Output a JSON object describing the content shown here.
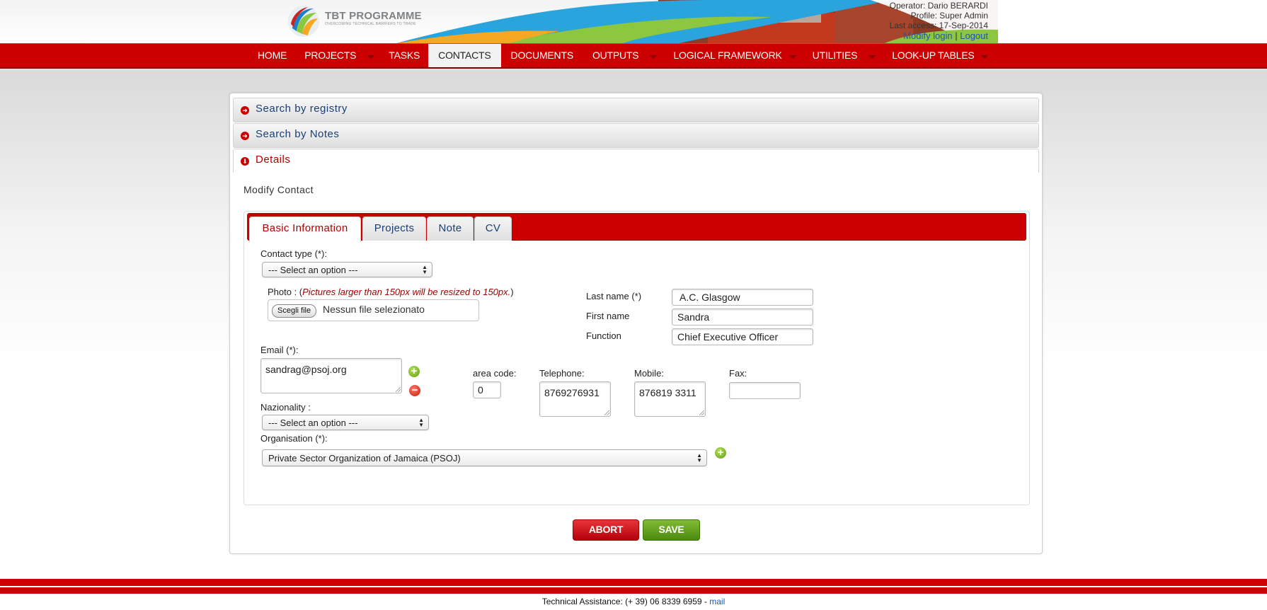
{
  "header": {
    "logo_title": "TBT PROGRAMME",
    "logo_tagline": "OVERCOMING TECHNICAL BARRIERS TO TRADE",
    "operator": "Operator: Dario BERARDI",
    "profile": "Profile: Super Admin",
    "last_access": "Last access: 17-Sep-2014",
    "modify_login": "Modify login",
    "separator": "|",
    "logout": "Logout"
  },
  "nav": {
    "items": [
      {
        "label": "HOME",
        "dropdown": false
      },
      {
        "label": "PROJECTS",
        "dropdown": true
      },
      {
        "label": "TASKS",
        "dropdown": false
      },
      {
        "label": "CONTACTS",
        "dropdown": false,
        "active": true
      },
      {
        "label": "DOCUMENTS",
        "dropdown": false
      },
      {
        "label": "OUTPUTS",
        "dropdown": true
      },
      {
        "label": "LOGICAL FRAMEWORK",
        "dropdown": true
      },
      {
        "label": "UTILITIES",
        "dropdown": true
      },
      {
        "label": "LOOK-UP TABLES",
        "dropdown": true
      }
    ]
  },
  "accordion": {
    "registry": "Search by registry",
    "notes": "Search by Notes",
    "details": "Details"
  },
  "details": {
    "title": "Modify Contact",
    "tabs": [
      "Basic Information",
      "Projects",
      "Note",
      "CV"
    ]
  },
  "form": {
    "contact_type_label": "Contact type (*):",
    "contact_type_value": "--- Select an option ---",
    "photo_label": "Photo : (",
    "photo_note": "Pictures larger than 150px will be resized to 150px.",
    "photo_label_end": ")",
    "file_button": "Scegli file",
    "file_none": "Nessun file selezionato",
    "last_name_label": "Last name (*)",
    "last_name_value": "A.C. Glasgow",
    "first_name_label": "First name",
    "first_name_value": "Sandra",
    "function_label": "Function",
    "function_value": "Chief Executive Officer",
    "email_label": "Email (*):",
    "email_value": "sandrag@psoj.org",
    "area_code_label": "area code:",
    "area_code_value": "0",
    "telephone_label": "Telephone:",
    "telephone_value": "8769276931",
    "mobile_label": "Mobile:",
    "mobile_value": "876819 3311",
    "fax_label": "Fax:",
    "fax_value": "",
    "nationality_label": "Nazionality :",
    "nationality_value": "--- Select an option ---",
    "organisation_label": "Organisation (*):",
    "organisation_value": "Private Sector Organization of Jamaica (PSOJ)"
  },
  "actions": {
    "abort": "ABORT",
    "save": "SAVE"
  },
  "footer": {
    "assistance": "Technical Assistance: (+ 39) 06 8339 6959 - ",
    "mail": "mail"
  },
  "colors": {
    "brand_red": "#cc0000",
    "link_blue": "#1d57a8",
    "save_green": "#5f9c10"
  }
}
